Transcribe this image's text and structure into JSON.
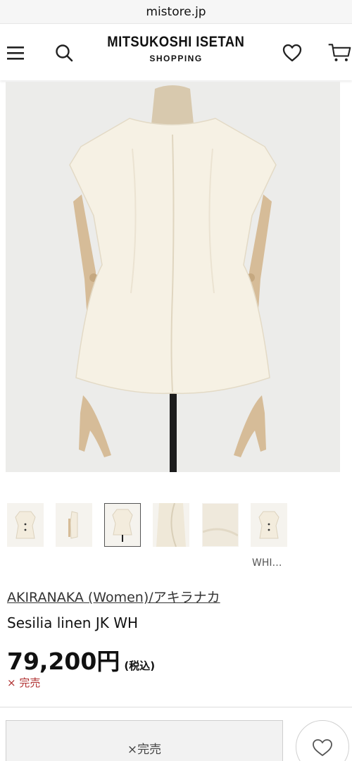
{
  "browser": {
    "url": "mistore.jp"
  },
  "header": {
    "menu_icon": "hamburger-menu-icon",
    "search_icon": "search-icon",
    "brand_name": "MITSUKOSHI ISETAN",
    "brand_sub": "SHOPPING",
    "favorite_icon": "heart-icon",
    "cart_icon": "cart-icon"
  },
  "product": {
    "main_image": "cream sleeveless peplum jacket on mannequin, back view",
    "thumbnails": [
      {
        "label": "front view"
      },
      {
        "label": "side view"
      },
      {
        "label": "back view",
        "active": true
      },
      {
        "label": "detail view"
      },
      {
        "label": "fabric close-up"
      },
      {
        "label": "front view alt"
      }
    ],
    "thumbnail_caption": "WHI…",
    "brand_link": "AKIRANAKA (Women)/アキラナカ",
    "name": "Sesilia linen JK WH",
    "price": "79,200円",
    "tax_label": "(税込)",
    "status": "× 完売"
  },
  "actions": {
    "soldout_label": "×完売",
    "favorite_icon": "heart-icon"
  },
  "colors": {
    "status_red": "#b03030",
    "garment": "#f6f1e4",
    "background": "#ececea"
  }
}
